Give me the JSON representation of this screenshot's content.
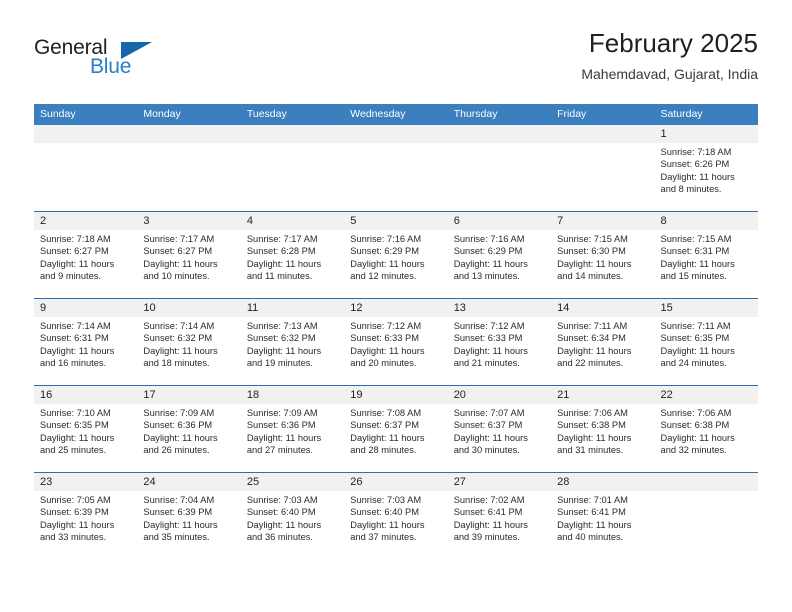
{
  "logo": {
    "word_top": "General",
    "word_bottom": "Blue",
    "triangle_color": "#1566ad",
    "blue_color": "#2a7fc9"
  },
  "header": {
    "title": "February 2025",
    "subtitle": "Mahemdavad, Gujarat, India"
  },
  "theme": {
    "header_band": "#3b7fbf",
    "row_divider": "#2a6fb0",
    "day_band": "#f1f1f1"
  },
  "weekday_headers": [
    "Sunday",
    "Monday",
    "Tuesday",
    "Wednesday",
    "Thursday",
    "Friday",
    "Saturday"
  ],
  "weeks": [
    [
      {
        "day": "",
        "sunrise": "",
        "sunset": "",
        "daylight_line1": "",
        "daylight_line2": ""
      },
      {
        "day": "",
        "sunrise": "",
        "sunset": "",
        "daylight_line1": "",
        "daylight_line2": ""
      },
      {
        "day": "",
        "sunrise": "",
        "sunset": "",
        "daylight_line1": "",
        "daylight_line2": ""
      },
      {
        "day": "",
        "sunrise": "",
        "sunset": "",
        "daylight_line1": "",
        "daylight_line2": ""
      },
      {
        "day": "",
        "sunrise": "",
        "sunset": "",
        "daylight_line1": "",
        "daylight_line2": ""
      },
      {
        "day": "",
        "sunrise": "",
        "sunset": "",
        "daylight_line1": "",
        "daylight_line2": ""
      },
      {
        "day": "1",
        "sunrise": "Sunrise: 7:18 AM",
        "sunset": "Sunset: 6:26 PM",
        "daylight_line1": "Daylight: 11 hours",
        "daylight_line2": "and 8 minutes."
      }
    ],
    [
      {
        "day": "2",
        "sunrise": "Sunrise: 7:18 AM",
        "sunset": "Sunset: 6:27 PM",
        "daylight_line1": "Daylight: 11 hours",
        "daylight_line2": "and 9 minutes."
      },
      {
        "day": "3",
        "sunrise": "Sunrise: 7:17 AM",
        "sunset": "Sunset: 6:27 PM",
        "daylight_line1": "Daylight: 11 hours",
        "daylight_line2": "and 10 minutes."
      },
      {
        "day": "4",
        "sunrise": "Sunrise: 7:17 AM",
        "sunset": "Sunset: 6:28 PM",
        "daylight_line1": "Daylight: 11 hours",
        "daylight_line2": "and 11 minutes."
      },
      {
        "day": "5",
        "sunrise": "Sunrise: 7:16 AM",
        "sunset": "Sunset: 6:29 PM",
        "daylight_line1": "Daylight: 11 hours",
        "daylight_line2": "and 12 minutes."
      },
      {
        "day": "6",
        "sunrise": "Sunrise: 7:16 AM",
        "sunset": "Sunset: 6:29 PM",
        "daylight_line1": "Daylight: 11 hours",
        "daylight_line2": "and 13 minutes."
      },
      {
        "day": "7",
        "sunrise": "Sunrise: 7:15 AM",
        "sunset": "Sunset: 6:30 PM",
        "daylight_line1": "Daylight: 11 hours",
        "daylight_line2": "and 14 minutes."
      },
      {
        "day": "8",
        "sunrise": "Sunrise: 7:15 AM",
        "sunset": "Sunset: 6:31 PM",
        "daylight_line1": "Daylight: 11 hours",
        "daylight_line2": "and 15 minutes."
      }
    ],
    [
      {
        "day": "9",
        "sunrise": "Sunrise: 7:14 AM",
        "sunset": "Sunset: 6:31 PM",
        "daylight_line1": "Daylight: 11 hours",
        "daylight_line2": "and 16 minutes."
      },
      {
        "day": "10",
        "sunrise": "Sunrise: 7:14 AM",
        "sunset": "Sunset: 6:32 PM",
        "daylight_line1": "Daylight: 11 hours",
        "daylight_line2": "and 18 minutes."
      },
      {
        "day": "11",
        "sunrise": "Sunrise: 7:13 AM",
        "sunset": "Sunset: 6:32 PM",
        "daylight_line1": "Daylight: 11 hours",
        "daylight_line2": "and 19 minutes."
      },
      {
        "day": "12",
        "sunrise": "Sunrise: 7:12 AM",
        "sunset": "Sunset: 6:33 PM",
        "daylight_line1": "Daylight: 11 hours",
        "daylight_line2": "and 20 minutes."
      },
      {
        "day": "13",
        "sunrise": "Sunrise: 7:12 AM",
        "sunset": "Sunset: 6:33 PM",
        "daylight_line1": "Daylight: 11 hours",
        "daylight_line2": "and 21 minutes."
      },
      {
        "day": "14",
        "sunrise": "Sunrise: 7:11 AM",
        "sunset": "Sunset: 6:34 PM",
        "daylight_line1": "Daylight: 11 hours",
        "daylight_line2": "and 22 minutes."
      },
      {
        "day": "15",
        "sunrise": "Sunrise: 7:11 AM",
        "sunset": "Sunset: 6:35 PM",
        "daylight_line1": "Daylight: 11 hours",
        "daylight_line2": "and 24 minutes."
      }
    ],
    [
      {
        "day": "16",
        "sunrise": "Sunrise: 7:10 AM",
        "sunset": "Sunset: 6:35 PM",
        "daylight_line1": "Daylight: 11 hours",
        "daylight_line2": "and 25 minutes."
      },
      {
        "day": "17",
        "sunrise": "Sunrise: 7:09 AM",
        "sunset": "Sunset: 6:36 PM",
        "daylight_line1": "Daylight: 11 hours",
        "daylight_line2": "and 26 minutes."
      },
      {
        "day": "18",
        "sunrise": "Sunrise: 7:09 AM",
        "sunset": "Sunset: 6:36 PM",
        "daylight_line1": "Daylight: 11 hours",
        "daylight_line2": "and 27 minutes."
      },
      {
        "day": "19",
        "sunrise": "Sunrise: 7:08 AM",
        "sunset": "Sunset: 6:37 PM",
        "daylight_line1": "Daylight: 11 hours",
        "daylight_line2": "and 28 minutes."
      },
      {
        "day": "20",
        "sunrise": "Sunrise: 7:07 AM",
        "sunset": "Sunset: 6:37 PM",
        "daylight_line1": "Daylight: 11 hours",
        "daylight_line2": "and 30 minutes."
      },
      {
        "day": "21",
        "sunrise": "Sunrise: 7:06 AM",
        "sunset": "Sunset: 6:38 PM",
        "daylight_line1": "Daylight: 11 hours",
        "daylight_line2": "and 31 minutes."
      },
      {
        "day": "22",
        "sunrise": "Sunrise: 7:06 AM",
        "sunset": "Sunset: 6:38 PM",
        "daylight_line1": "Daylight: 11 hours",
        "daylight_line2": "and 32 minutes."
      }
    ],
    [
      {
        "day": "23",
        "sunrise": "Sunrise: 7:05 AM",
        "sunset": "Sunset: 6:39 PM",
        "daylight_line1": "Daylight: 11 hours",
        "daylight_line2": "and 33 minutes."
      },
      {
        "day": "24",
        "sunrise": "Sunrise: 7:04 AM",
        "sunset": "Sunset: 6:39 PM",
        "daylight_line1": "Daylight: 11 hours",
        "daylight_line2": "and 35 minutes."
      },
      {
        "day": "25",
        "sunrise": "Sunrise: 7:03 AM",
        "sunset": "Sunset: 6:40 PM",
        "daylight_line1": "Daylight: 11 hours",
        "daylight_line2": "and 36 minutes."
      },
      {
        "day": "26",
        "sunrise": "Sunrise: 7:03 AM",
        "sunset": "Sunset: 6:40 PM",
        "daylight_line1": "Daylight: 11 hours",
        "daylight_line2": "and 37 minutes."
      },
      {
        "day": "27",
        "sunrise": "Sunrise: 7:02 AM",
        "sunset": "Sunset: 6:41 PM",
        "daylight_line1": "Daylight: 11 hours",
        "daylight_line2": "and 39 minutes."
      },
      {
        "day": "28",
        "sunrise": "Sunrise: 7:01 AM",
        "sunset": "Sunset: 6:41 PM",
        "daylight_line1": "Daylight: 11 hours",
        "daylight_line2": "and 40 minutes."
      },
      {
        "day": "",
        "sunrise": "",
        "sunset": "",
        "daylight_line1": "",
        "daylight_line2": ""
      }
    ]
  ]
}
